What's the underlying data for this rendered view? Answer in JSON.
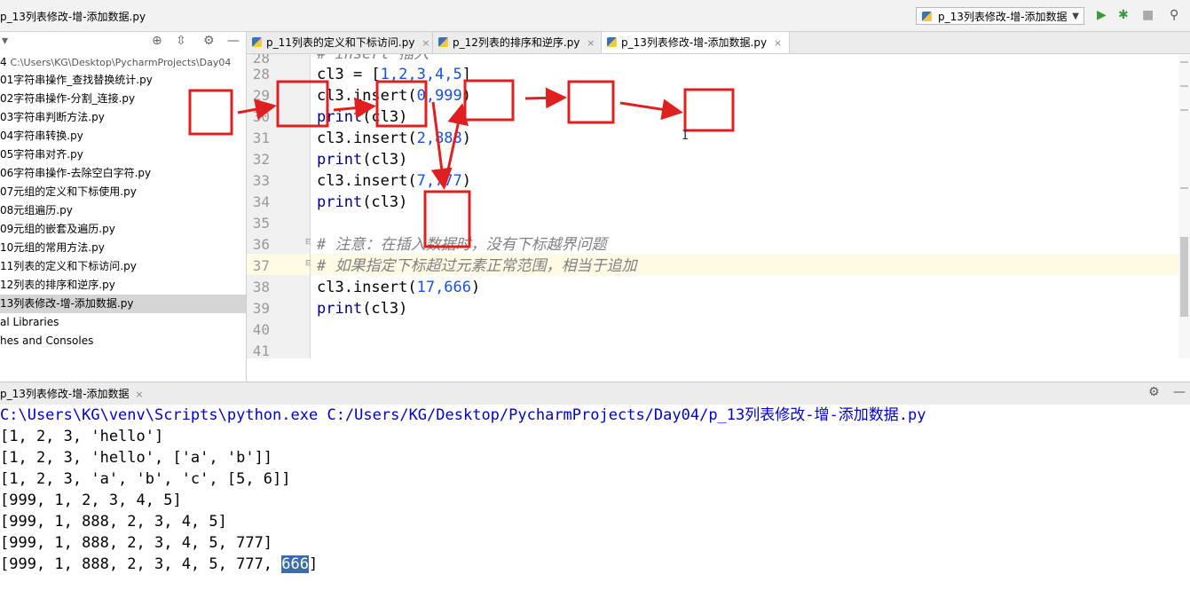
{
  "window": {
    "title": "p_13列表修改-增-添加数据.py"
  },
  "run_config": {
    "label": "p_13列表修改-增-添加数据",
    "run_icon": "play-icon",
    "debug_icon": "bug-icon"
  },
  "project": {
    "root_label": "4",
    "root_path": "C:\\Users\\KG\\Desktop\\PycharmProjects\\Day04",
    "files": [
      "01字符串操作_查找替换统计.py",
      "02字符串操作-分割_连接.py",
      "03字符串判断方法.py",
      "04字符串转换.py",
      "05字符串对齐.py",
      "06字符串操作-去除空白字符.py",
      "07元组的定义和下标使用.py",
      "08元组遍历.py",
      "09元组的嵌套及遍历.py",
      "10元组的常用方法.py",
      "11列表的定义和下标访问.py",
      "12列表的排序和逆序.py",
      "13列表修改-增-添加数据.py"
    ],
    "extra": [
      "al Libraries",
      "hes and Consoles"
    ]
  },
  "tabs": [
    {
      "label": "p_11列表的定义和下标访问.py",
      "close": "×"
    },
    {
      "label": "p_12列表的排序和逆序.py",
      "close": "×"
    },
    {
      "label": "p_13列表修改-增-添加数据.py",
      "close": "×"
    }
  ],
  "editor": {
    "line_numbers": [
      "28",
      "29",
      "30",
      "31",
      "32",
      "33",
      "34",
      "35",
      "36",
      "37",
      "38",
      "39",
      "40",
      "41"
    ],
    "lines": {
      "l27_comment": "# insert 插入",
      "l28_a": "cl3 = [",
      "l28_n": "1,2,3,4,5",
      "l28_b": "]",
      "l29_a": "cl3.insert(",
      "l29_n": "0,999",
      "l29_b": ")",
      "l30_fn": "print",
      "l30_b": "(cl3)",
      "l31_a": "cl3.insert(",
      "l31_n": "2,888",
      "l31_b": ")",
      "l32_fn": "print",
      "l32_b": "(cl3)",
      "l33_a": "cl3.insert(",
      "l33_n": "7,777",
      "l33_b": ")",
      "l34_fn": "print",
      "l34_b": "(cl3)",
      "l36": "# 注意：在插入数据时，没有下标越界问题",
      "l37": "# 如果指定下标超过元素正常范围，相当于追加",
      "l38_a": "cl3.insert(",
      "l38_n": "17,666",
      "l38_b": ")",
      "l39_fn": "print",
      "l39_b": "(cl3)"
    }
  },
  "run_panel": {
    "tab_label": "p_13列表修改-增-添加数据",
    "tab_close": "×"
  },
  "console": {
    "command": "C:\\Users\\KG\\venv\\Scripts\\python.exe C:/Users/KG/Desktop/PycharmProjects/Day04/p_13列表修改-增-添加数据.py",
    "outputs": [
      "[1, 2, 3, 'hello']",
      "[1, 2, 3, 'hello', ['a', 'b']]",
      "[1, 2, 3, 'a', 'b', 'c', [5, 6]]",
      "[999, 1, 2, 3, 4, 5]",
      "[999, 1, 888, 2, 3, 4, 5]",
      "[999, 1, 888, 2, 3, 4, 5, 777]"
    ],
    "last_prefix": "[999, 1, 888, 2, 3, 4, 5, 777, ",
    "last_selected": "666",
    "last_suffix": "]"
  },
  "colors": {
    "annotation": "#e02020",
    "selection": "#3a6ea8",
    "number": "#1750eb",
    "comment": "#808080"
  }
}
